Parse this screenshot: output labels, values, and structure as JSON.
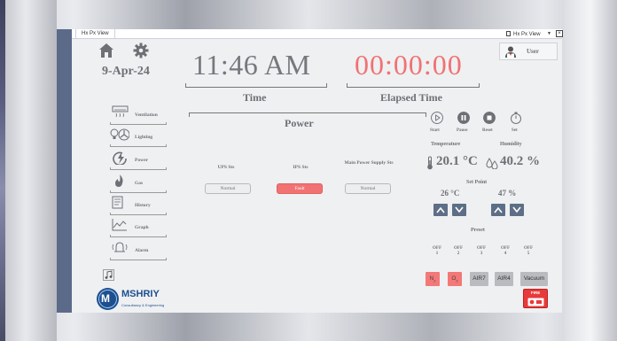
{
  "window": {
    "tab_left": "Hx Px View",
    "tab_right": "Hx Px View"
  },
  "header": {
    "date": "9-Apr-24",
    "user_label": "User"
  },
  "clock": {
    "time": "11:46 AM",
    "time_label": "Time",
    "elapsed": "00:00:00",
    "elapsed_label": "Elapsed Time"
  },
  "power": {
    "title": "Power",
    "ups": {
      "label": "UPS Sts",
      "status": "Normal"
    },
    "ips": {
      "label": "IPS Sts",
      "status": "Fault"
    },
    "main": {
      "label": "Main Power Supply Sts",
      "status": "Normal"
    }
  },
  "sidebar": {
    "items": [
      {
        "label": "Ventilation",
        "icon": "ac-unit-icon"
      },
      {
        "label": "Lighting",
        "icon": "bulb-fan-icon"
      },
      {
        "label": "Power",
        "icon": "power-icon"
      },
      {
        "label": "Gas",
        "icon": "flame-icon"
      },
      {
        "label": "History",
        "icon": "history-icon"
      },
      {
        "label": "Graph",
        "icon": "graph-icon"
      },
      {
        "label": "Alarm",
        "icon": "alarm-icon"
      }
    ]
  },
  "timer_controls": {
    "start": "Start",
    "pause": "Pause",
    "reset": "Reset",
    "set": "Set"
  },
  "environment": {
    "temperature_label": "Temperature",
    "humidity_label": "Humidity",
    "temperature_value": "20.1 °C",
    "humidity_value": "40.2 %"
  },
  "setpoint": {
    "label": "Set Point",
    "temperature": "26 °C",
    "humidity": "47 %"
  },
  "preset": {
    "label": "Preset",
    "items": [
      {
        "state": "OFF",
        "num": "1"
      },
      {
        "state": "OFF",
        "num": "2"
      },
      {
        "state": "OFF",
        "num": "3"
      },
      {
        "state": "OFF",
        "num": "4"
      },
      {
        "state": "OFF",
        "num": "5"
      }
    ]
  },
  "gases": {
    "n2": "N",
    "n2_sub": "2",
    "o2": "O",
    "o2_sub": "2",
    "air7": "AIR7",
    "air4": "AIR4",
    "vacuum": "Vacuum"
  },
  "fire": {
    "label": "FIRE"
  },
  "logo": {
    "name": "MSHRIY",
    "tagline": "Consultancy & Engineering",
    "mark": "M"
  },
  "colors": {
    "accent_red": "#f07273",
    "steel_blue": "#5d6f86",
    "text_gray": "#6e7075"
  }
}
